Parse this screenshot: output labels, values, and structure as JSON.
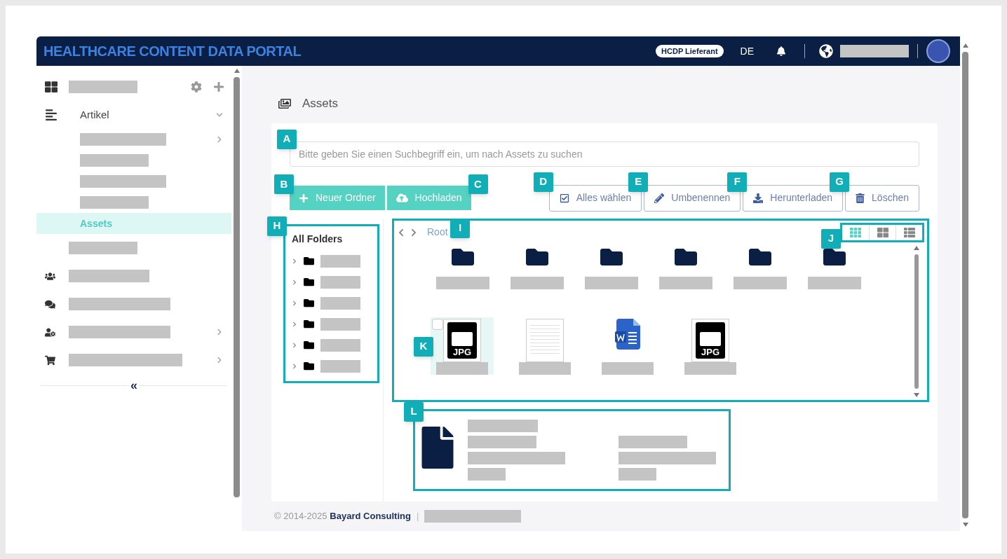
{
  "header": {
    "title": "HEALTHCARE CONTENT DATA PORTAL",
    "role_badge": "HCDP Lieferant",
    "language": "DE"
  },
  "sidebar": {
    "items": [
      {
        "kind": "dashboard",
        "expandable": false
      },
      {
        "kind": "articles",
        "label": "Artikel",
        "expandable": true,
        "expanded": true,
        "children": [
          {
            "expandable": true,
            "selected": false
          },
          {
            "selected": false
          },
          {
            "selected": false
          },
          {
            "selected": false
          },
          {
            "label": "Assets",
            "selected": true
          }
        ]
      },
      {
        "kind": "blank",
        "expandable": false
      },
      {
        "kind": "users",
        "expandable": false
      },
      {
        "kind": "messages",
        "expandable": false
      },
      {
        "kind": "user-settings",
        "expandable": true
      },
      {
        "kind": "cart",
        "expandable": true
      }
    ],
    "collapse": "«"
  },
  "page": {
    "title": "Assets",
    "search": {
      "placeholder": "Bitte geben Sie einen Suchbegriff ein, um nach Assets zu suchen",
      "annotation": "A"
    },
    "primary_buttons": [
      {
        "kind": "new-folder",
        "label": "Neuer Ordner",
        "annotation": "B"
      },
      {
        "kind": "upload",
        "label": "Hochladen",
        "annotation": "C"
      }
    ],
    "secondary_buttons": [
      {
        "kind": "select-all",
        "label": "Alles wählen",
        "annotation": "D"
      },
      {
        "kind": "rename",
        "label": "Umbenennen",
        "annotation": "E"
      },
      {
        "kind": "download",
        "label": "Herunterladen",
        "annotation": "F"
      },
      {
        "kind": "delete",
        "label": "Löschen",
        "annotation": "G"
      }
    ],
    "folder_tree": {
      "title": "All Folders",
      "annotation": "H",
      "items": [
        {
          "expanded": false
        },
        {
          "expanded": false
        },
        {
          "expanded": false
        },
        {
          "expanded": false
        },
        {
          "expanded": false
        },
        {
          "expanded": false
        }
      ]
    },
    "browser": {
      "breadcrumb": "Root",
      "annotation": "I",
      "views": {
        "annotation": "J",
        "items": [
          {
            "kind": "small-grid",
            "selected": true
          },
          {
            "kind": "large-grid",
            "selected": false
          },
          {
            "kind": "list",
            "selected": false
          }
        ]
      },
      "folders": [
        {
          "kind": "folder"
        },
        {
          "kind": "folder"
        },
        {
          "kind": "folder"
        },
        {
          "kind": "folder"
        },
        {
          "kind": "folder"
        },
        {
          "kind": "folder"
        }
      ],
      "files": [
        {
          "kind": "image",
          "badge": "JPG",
          "selected": true,
          "checked": false,
          "annotation": "K"
        },
        {
          "kind": "document",
          "selected": false
        },
        {
          "kind": "word",
          "selected": false
        },
        {
          "kind": "image",
          "badge": "JPG",
          "selected": false
        }
      ]
    },
    "details": {
      "annotation": "L"
    }
  },
  "footer": {
    "copyright": "© 2014-2025",
    "company": "Bayard Consulting",
    "separator": "|"
  }
}
